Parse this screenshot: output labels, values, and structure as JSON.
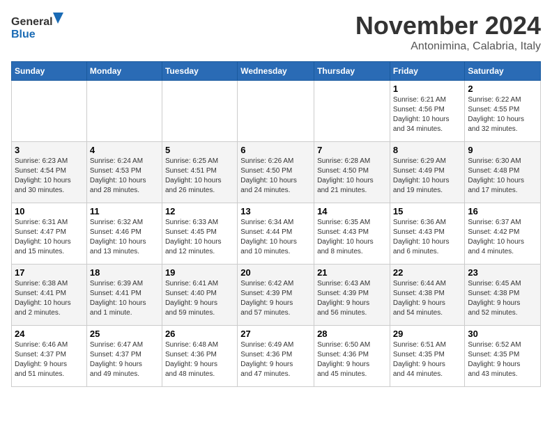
{
  "logo": {
    "line1": "General",
    "line2": "Blue"
  },
  "header": {
    "month": "November 2024",
    "location": "Antonimina, Calabria, Italy"
  },
  "weekdays": [
    "Sunday",
    "Monday",
    "Tuesday",
    "Wednesday",
    "Thursday",
    "Friday",
    "Saturday"
  ],
  "weeks": [
    [
      {
        "day": "",
        "info": ""
      },
      {
        "day": "",
        "info": ""
      },
      {
        "day": "",
        "info": ""
      },
      {
        "day": "",
        "info": ""
      },
      {
        "day": "",
        "info": ""
      },
      {
        "day": "1",
        "info": "Sunrise: 6:21 AM\nSunset: 4:56 PM\nDaylight: 10 hours\nand 34 minutes."
      },
      {
        "day": "2",
        "info": "Sunrise: 6:22 AM\nSunset: 4:55 PM\nDaylight: 10 hours\nand 32 minutes."
      }
    ],
    [
      {
        "day": "3",
        "info": "Sunrise: 6:23 AM\nSunset: 4:54 PM\nDaylight: 10 hours\nand 30 minutes."
      },
      {
        "day": "4",
        "info": "Sunrise: 6:24 AM\nSunset: 4:53 PM\nDaylight: 10 hours\nand 28 minutes."
      },
      {
        "day": "5",
        "info": "Sunrise: 6:25 AM\nSunset: 4:51 PM\nDaylight: 10 hours\nand 26 minutes."
      },
      {
        "day": "6",
        "info": "Sunrise: 6:26 AM\nSunset: 4:50 PM\nDaylight: 10 hours\nand 24 minutes."
      },
      {
        "day": "7",
        "info": "Sunrise: 6:28 AM\nSunset: 4:50 PM\nDaylight: 10 hours\nand 21 minutes."
      },
      {
        "day": "8",
        "info": "Sunrise: 6:29 AM\nSunset: 4:49 PM\nDaylight: 10 hours\nand 19 minutes."
      },
      {
        "day": "9",
        "info": "Sunrise: 6:30 AM\nSunset: 4:48 PM\nDaylight: 10 hours\nand 17 minutes."
      }
    ],
    [
      {
        "day": "10",
        "info": "Sunrise: 6:31 AM\nSunset: 4:47 PM\nDaylight: 10 hours\nand 15 minutes."
      },
      {
        "day": "11",
        "info": "Sunrise: 6:32 AM\nSunset: 4:46 PM\nDaylight: 10 hours\nand 13 minutes."
      },
      {
        "day": "12",
        "info": "Sunrise: 6:33 AM\nSunset: 4:45 PM\nDaylight: 10 hours\nand 12 minutes."
      },
      {
        "day": "13",
        "info": "Sunrise: 6:34 AM\nSunset: 4:44 PM\nDaylight: 10 hours\nand 10 minutes."
      },
      {
        "day": "14",
        "info": "Sunrise: 6:35 AM\nSunset: 4:43 PM\nDaylight: 10 hours\nand 8 minutes."
      },
      {
        "day": "15",
        "info": "Sunrise: 6:36 AM\nSunset: 4:43 PM\nDaylight: 10 hours\nand 6 minutes."
      },
      {
        "day": "16",
        "info": "Sunrise: 6:37 AM\nSunset: 4:42 PM\nDaylight: 10 hours\nand 4 minutes."
      }
    ],
    [
      {
        "day": "17",
        "info": "Sunrise: 6:38 AM\nSunset: 4:41 PM\nDaylight: 10 hours\nand 2 minutes."
      },
      {
        "day": "18",
        "info": "Sunrise: 6:39 AM\nSunset: 4:41 PM\nDaylight: 10 hours\nand 1 minute."
      },
      {
        "day": "19",
        "info": "Sunrise: 6:41 AM\nSunset: 4:40 PM\nDaylight: 9 hours\nand 59 minutes."
      },
      {
        "day": "20",
        "info": "Sunrise: 6:42 AM\nSunset: 4:39 PM\nDaylight: 9 hours\nand 57 minutes."
      },
      {
        "day": "21",
        "info": "Sunrise: 6:43 AM\nSunset: 4:39 PM\nDaylight: 9 hours\nand 56 minutes."
      },
      {
        "day": "22",
        "info": "Sunrise: 6:44 AM\nSunset: 4:38 PM\nDaylight: 9 hours\nand 54 minutes."
      },
      {
        "day": "23",
        "info": "Sunrise: 6:45 AM\nSunset: 4:38 PM\nDaylight: 9 hours\nand 52 minutes."
      }
    ],
    [
      {
        "day": "24",
        "info": "Sunrise: 6:46 AM\nSunset: 4:37 PM\nDaylight: 9 hours\nand 51 minutes."
      },
      {
        "day": "25",
        "info": "Sunrise: 6:47 AM\nSunset: 4:37 PM\nDaylight: 9 hours\nand 49 minutes."
      },
      {
        "day": "26",
        "info": "Sunrise: 6:48 AM\nSunset: 4:36 PM\nDaylight: 9 hours\nand 48 minutes."
      },
      {
        "day": "27",
        "info": "Sunrise: 6:49 AM\nSunset: 4:36 PM\nDaylight: 9 hours\nand 47 minutes."
      },
      {
        "day": "28",
        "info": "Sunrise: 6:50 AM\nSunset: 4:36 PM\nDaylight: 9 hours\nand 45 minutes."
      },
      {
        "day": "29",
        "info": "Sunrise: 6:51 AM\nSunset: 4:35 PM\nDaylight: 9 hours\nand 44 minutes."
      },
      {
        "day": "30",
        "info": "Sunrise: 6:52 AM\nSunset: 4:35 PM\nDaylight: 9 hours\nand 43 minutes."
      }
    ]
  ]
}
